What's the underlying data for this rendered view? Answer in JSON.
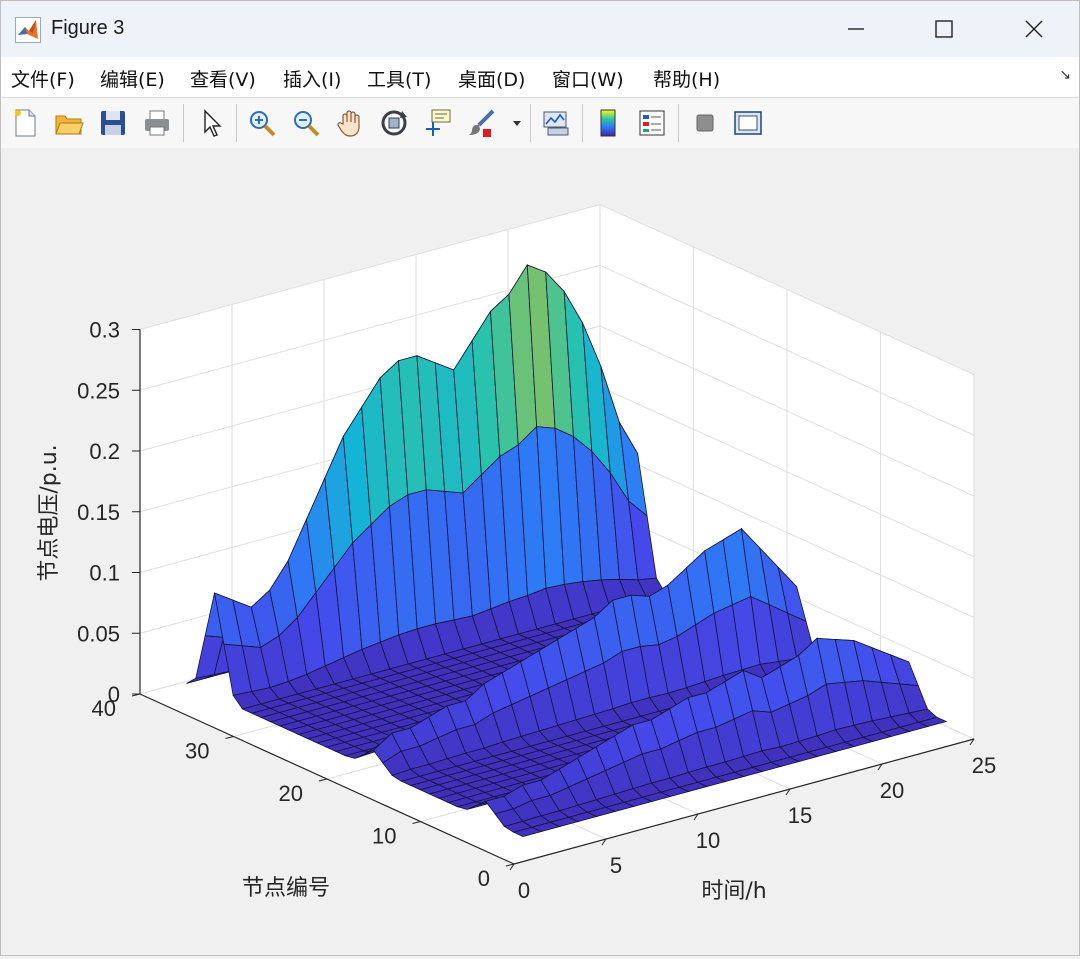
{
  "window": {
    "title": "Figure 3"
  },
  "menu": [
    {
      "label": "文件(F)"
    },
    {
      "label": "编辑(E)"
    },
    {
      "label": "查看(V)"
    },
    {
      "label": "插入(I)"
    },
    {
      "label": "工具(T)"
    },
    {
      "label": "桌面(D)"
    },
    {
      "label": "窗口(W)"
    },
    {
      "label": "帮助(H)"
    }
  ],
  "toolbar": [
    {
      "icon": "new-figure-icon"
    },
    {
      "icon": "open-file-icon"
    },
    {
      "icon": "save-icon"
    },
    {
      "icon": "print-icon"
    },
    {
      "icon": "pointer-icon"
    },
    {
      "icon": "zoom-in-icon"
    },
    {
      "icon": "zoom-out-icon"
    },
    {
      "icon": "pan-hand-icon"
    },
    {
      "icon": "rotate-3d-icon"
    },
    {
      "icon": "data-cursor-icon"
    },
    {
      "icon": "brush-icon"
    },
    {
      "icon": "dropdown-arrow-icon"
    },
    {
      "icon": "link-plot-icon"
    },
    {
      "icon": "colorbar-icon"
    },
    {
      "icon": "legend-icon"
    },
    {
      "icon": "hide-plot-tools-icon"
    },
    {
      "icon": "show-plot-tools-icon"
    }
  ],
  "chart_data": {
    "type": "surface",
    "xlabel": "时间/h",
    "ylabel": "节点编号",
    "zlabel": "节点电压/p.u.",
    "xlim": [
      0,
      25
    ],
    "ylim": [
      0,
      40
    ],
    "zlim": [
      0,
      0.3
    ],
    "x_ticks": [
      "0",
      "5",
      "10",
      "15",
      "20",
      "25"
    ],
    "y_ticks": [
      "0",
      "10",
      "20",
      "30",
      "40"
    ],
    "z_ticks": [
      "0",
      "0.05",
      "0.1",
      "0.15",
      "0.2",
      "0.25",
      "0.3"
    ],
    "grid": true,
    "colormap": "parula",
    "colors": {
      "low": "#3e26a8",
      "mid_blue": "#2d7cf5",
      "teal": "#2cc4a7",
      "yellow": "#f5c22e"
    },
    "ridges": [
      {
        "node": 5,
        "hours": [
          1,
          2,
          3,
          4,
          5,
          6,
          7,
          8,
          9,
          10,
          11,
          12,
          13,
          14,
          15,
          16,
          17,
          18,
          19,
          20,
          21,
          22,
          23,
          24
        ],
        "values": [
          0.03,
          0.03,
          0.035,
          0.035,
          0.04,
          0.045,
          0.05,
          0.055,
          0.06,
          0.06,
          0.065,
          0.07,
          0.07,
          0.075,
          0.08,
          0.07,
          0.075,
          0.08,
          0.09,
          0.085,
          0.08,
          0.07,
          0.06,
          0.05
        ]
      },
      {
        "node": 17,
        "hours": [
          1,
          2,
          3,
          4,
          5,
          6,
          7,
          8,
          9,
          10,
          11,
          12,
          13,
          14,
          15,
          16,
          17,
          18,
          19,
          20,
          21,
          22,
          23,
          24
        ],
        "values": [
          0.03,
          0.04,
          0.04,
          0.045,
          0.05,
          0.05,
          0.06,
          0.065,
          0.07,
          0.075,
          0.08,
          0.085,
          0.09,
          0.1,
          0.1,
          0.095,
          0.1,
          0.11,
          0.12,
          0.125,
          0.13,
          0.11,
          0.09,
          0.07
        ]
      },
      {
        "node": 34,
        "hours": [
          1,
          2,
          3,
          4,
          5,
          6,
          7,
          8,
          9,
          10,
          11,
          12,
          13,
          14,
          15,
          16,
          17,
          18,
          19,
          20,
          21,
          22,
          23,
          24
        ],
        "values": [
          0.1,
          0.09,
          0.08,
          0.09,
          0.11,
          0.14,
          0.17,
          0.2,
          0.22,
          0.24,
          0.25,
          0.25,
          0.24,
          0.23,
          0.25,
          0.27,
          0.28,
          0.3,
          0.29,
          0.27,
          0.24,
          0.2,
          0.15,
          0.12
        ]
      }
    ]
  }
}
